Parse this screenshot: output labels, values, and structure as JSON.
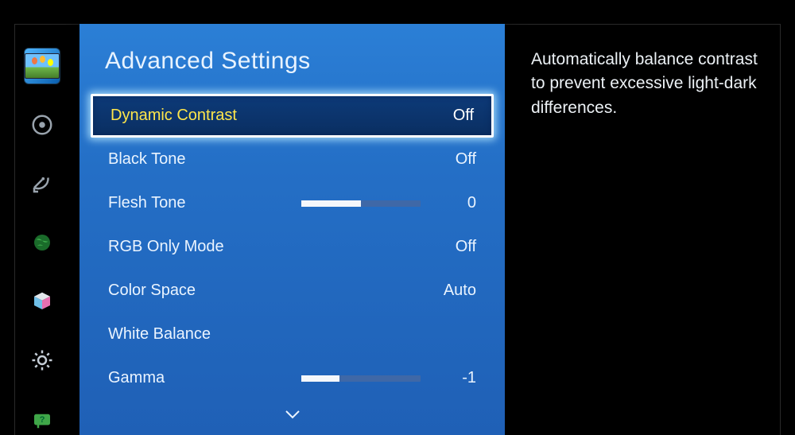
{
  "title": "Advanced Settings",
  "description": "Automatically balance contrast to prevent excessive light-dark differences.",
  "rail": {
    "items": [
      {
        "name": "picture",
        "active": true
      },
      {
        "name": "sound"
      },
      {
        "name": "network"
      },
      {
        "name": "smart"
      },
      {
        "name": "cube"
      },
      {
        "name": "system"
      },
      {
        "name": "support"
      }
    ]
  },
  "rows": [
    {
      "key": "dynamic_contrast",
      "label": "Dynamic Contrast",
      "value": "Off",
      "selected": true
    },
    {
      "key": "black_tone",
      "label": "Black Tone",
      "value": "Off"
    },
    {
      "key": "flesh_tone",
      "label": "Flesh Tone",
      "value": "0",
      "slider": {
        "percent": 50
      }
    },
    {
      "key": "rgb_only_mode",
      "label": "RGB Only Mode",
      "value": "Off"
    },
    {
      "key": "color_space",
      "label": "Color Space",
      "value": "Auto"
    },
    {
      "key": "white_balance",
      "label": "White Balance",
      "value": ""
    },
    {
      "key": "gamma",
      "label": "Gamma",
      "value": "-1",
      "slider": {
        "percent": 32
      }
    }
  ],
  "has_more": true
}
